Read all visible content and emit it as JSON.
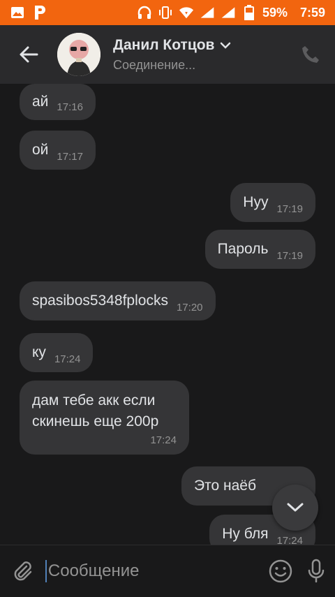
{
  "status_bar": {
    "battery": "59%",
    "time": "7:59",
    "icons": [
      "gallery-icon",
      "p-app-icon",
      "headphones-icon",
      "vibrate-icon",
      "wifi-icon",
      "signal-icon",
      "signal-icon",
      "battery-icon"
    ]
  },
  "header": {
    "title": "Данил Котцов",
    "subtitle": "Соединение..."
  },
  "messages": [
    {
      "direction": "in",
      "text": "ай",
      "time": "17:16"
    },
    {
      "direction": "in",
      "text": "ой",
      "time": "17:17"
    },
    {
      "direction": "out",
      "text": "Нуу",
      "time": "17:19"
    },
    {
      "direction": "out",
      "text": "Пароль",
      "time": "17:19"
    },
    {
      "direction": "in",
      "text": "spasibos5348fplocks",
      "time": "17:20"
    },
    {
      "direction": "in",
      "text": "ку",
      "time": "17:24"
    },
    {
      "direction": "in",
      "text": "дам тебе акк если\nскинешь еще 200р",
      "time": "17:24"
    },
    {
      "direction": "out",
      "text": "Это наёб",
      "time": ""
    },
    {
      "direction": "out",
      "text": "Ну бля",
      "time": "17:24"
    }
  ],
  "composer": {
    "placeholder": "Сообщение"
  },
  "colors": {
    "status_bar": "#f2650f",
    "header_bg": "#2a2a2c",
    "chat_bg": "#19191a",
    "bubble_bg": "#353537",
    "accent": "#5181b8"
  }
}
